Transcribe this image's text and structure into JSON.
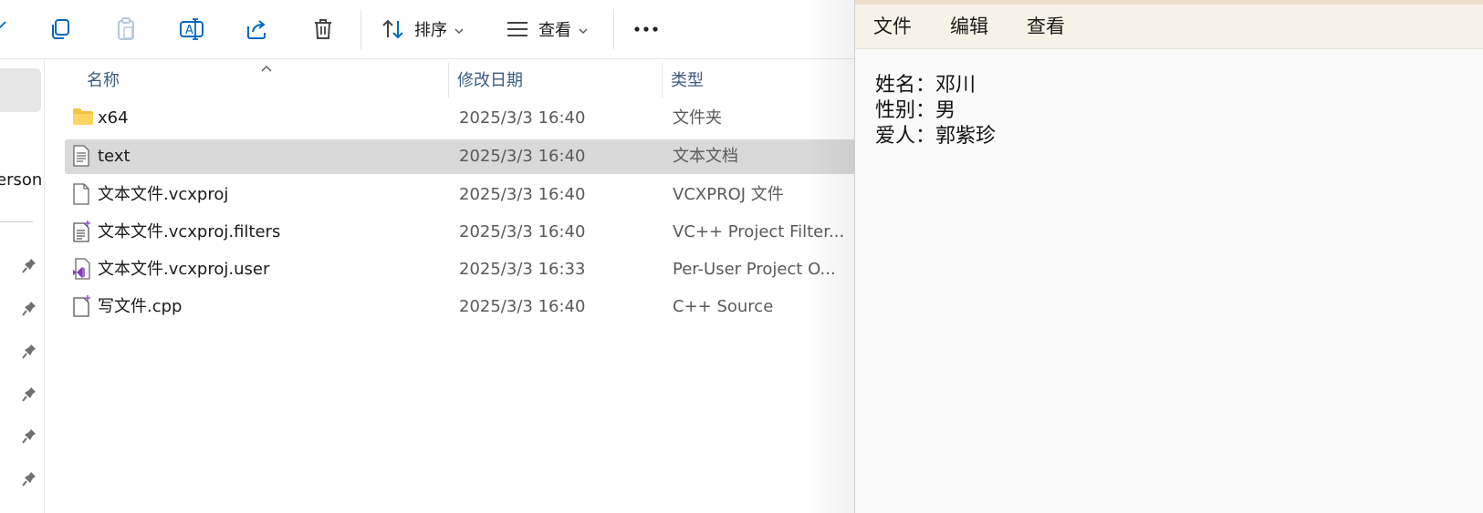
{
  "toolbar": {
    "sort_label": "排序",
    "view_label": "查看",
    "icons": [
      "cut-icon",
      "copy-icon",
      "paste-icon",
      "rename-icon",
      "share-icon",
      "delete-icon",
      "sort-icon",
      "view-icon",
      "more-icon"
    ]
  },
  "nav": {
    "partial_label": "erson"
  },
  "columns": {
    "name": "名称",
    "date": "修改日期",
    "type": "类型"
  },
  "files": [
    {
      "name": "x64",
      "date": "2025/3/3 16:40",
      "type": "文件夹",
      "icon": "folder-icon"
    },
    {
      "name": "text",
      "date": "2025/3/3 16:40",
      "type": "文本文档",
      "icon": "text-document-icon",
      "selected": true
    },
    {
      "name": "文本文件.vcxproj",
      "date": "2025/3/3 16:40",
      "type": "VCXPROJ 文件",
      "icon": "blank-file-icon"
    },
    {
      "name": "文本文件.vcxproj.filters",
      "date": "2025/3/3 16:40",
      "type": "VC++ Project Filter...",
      "icon": "filters-file-icon"
    },
    {
      "name": "文本文件.vcxproj.user",
      "date": "2025/3/3 16:33",
      "type": "Per-User Project O...",
      "icon": "visual-studio-file-icon"
    },
    {
      "name": "写文件.cpp",
      "date": "2025/3/3 16:40",
      "type": "C++ Source",
      "icon": "cpp-file-icon"
    }
  ],
  "notepad": {
    "menu": [
      "文件",
      "编辑",
      "查看"
    ],
    "lines": [
      "姓名：邓川",
      "性别：男",
      "爱人：郭紫珍"
    ]
  },
  "colors": {
    "selection": "#d9d9d9",
    "header_text": "#3d5a80",
    "accent_blue": "#0067c0",
    "folder": "#f5c242",
    "notepad_menubar": "#f7f2e8"
  }
}
